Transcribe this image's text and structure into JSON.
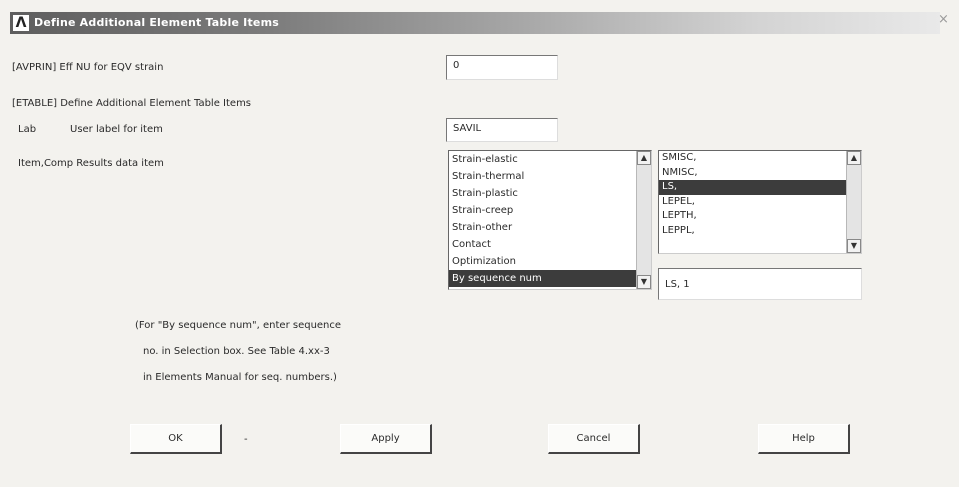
{
  "dialog": {
    "title": "Define Additional Element Table Items",
    "logo": "Λ",
    "close_glyph": "×"
  },
  "avprin": {
    "label": "[AVPRIN]  Eff NU for EQV strain",
    "value": "0"
  },
  "etable": {
    "heading": "[ETABLE]  Define Additional Element Table Items",
    "lab_key": "Lab",
    "lab_desc": "User label for item",
    "lab_value": "SAVIL",
    "item_label": "Item,Comp  Results data item"
  },
  "category_list": {
    "items": [
      "Strain-elastic",
      "Strain-thermal",
      "Strain-plastic",
      "Strain-creep",
      "Strain-other",
      "Contact",
      "Optimization",
      "By sequence num"
    ],
    "selected": "By sequence num"
  },
  "component_list": {
    "items": [
      "SMISC,",
      "NMISC,",
      "LS,",
      "LEPEL,",
      "LEPTH,",
      "LEPPL,"
    ],
    "selected": "LS,"
  },
  "selection": {
    "value": "LS, 1"
  },
  "note": {
    "line1": "(For \"By sequence num\", enter sequence",
    "line2": "no. in Selection box.  See Table 4.xx-3",
    "line3": "in Elements Manual for seq. numbers.)"
  },
  "buttons": {
    "ok": "OK",
    "apply": "Apply",
    "cancel": "Cancel",
    "help": "Help",
    "apply_prefix": "-"
  }
}
